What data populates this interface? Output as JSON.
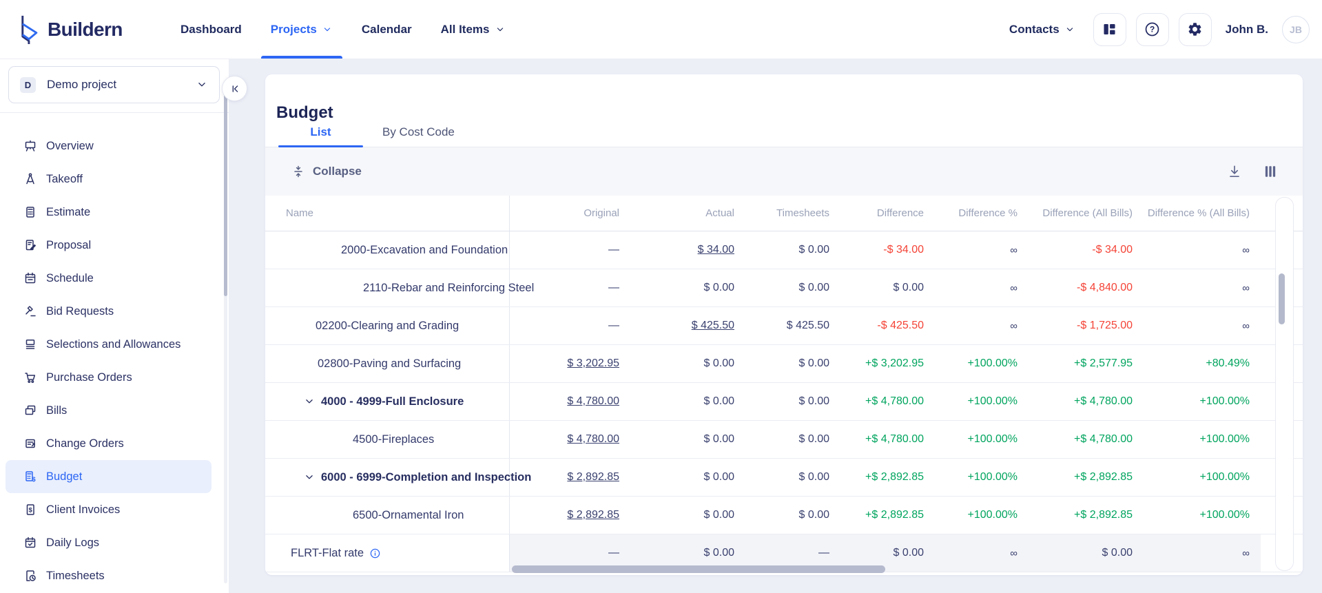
{
  "colors": {
    "accent": "#2d66f4",
    "navy": "#262e61",
    "red": "#f44336",
    "green": "#00a45e",
    "muted": "#9aa2b8",
    "bg": "#edeff7",
    "toolbar-bg": "#f6f7fa",
    "active-bg": "#e9effc",
    "scroll-thumb": "#b6bace"
  },
  "topbar": {
    "brand": "Buildern",
    "nav": [
      {
        "label": "Dashboard",
        "active": false,
        "chevron": false
      },
      {
        "label": "Projects",
        "active": true,
        "chevron": true
      },
      {
        "label": "Calendar",
        "active": false,
        "chevron": false
      },
      {
        "label": "All Items",
        "active": false,
        "chevron": true
      }
    ],
    "contacts_label": "Contacts",
    "user_name": "John B.",
    "avatar_initials": "JB"
  },
  "sidebar": {
    "project": {
      "badge": "D",
      "name": "Demo project"
    },
    "items": [
      {
        "label": "Overview",
        "icon": "easel"
      },
      {
        "label": "Takeoff",
        "icon": "compass"
      },
      {
        "label": "Estimate",
        "icon": "calculator"
      },
      {
        "label": "Proposal",
        "icon": "document-pen"
      },
      {
        "label": "Schedule",
        "icon": "calendar"
      },
      {
        "label": "Bid Requests",
        "icon": "gavel"
      },
      {
        "label": "Selections and Allowances",
        "icon": "layers"
      },
      {
        "label": "Purchase Orders",
        "icon": "cart"
      },
      {
        "label": "Bills",
        "icon": "bills"
      },
      {
        "label": "Change Orders",
        "icon": "doc-arrow"
      },
      {
        "label": "Budget",
        "icon": "budget",
        "active": true
      },
      {
        "label": "Client Invoices",
        "icon": "invoice"
      },
      {
        "label": "Daily Logs",
        "icon": "calendar-check"
      },
      {
        "label": "Timesheets",
        "icon": "doc-clock"
      }
    ]
  },
  "page": {
    "title": "Budget",
    "tabs": [
      {
        "label": "List",
        "active": true
      },
      {
        "label": "By Cost Code",
        "active": false
      }
    ],
    "toolbar": {
      "collapse_label": "Collapse"
    }
  },
  "table": {
    "columns": [
      "Name",
      "Original",
      "Actual",
      "Timesheets",
      "Difference",
      "Difference %",
      "Difference (All Bills)",
      "Difference % (All Bills)"
    ],
    "rows": [
      {
        "name": "2000-Excavation and Foundation",
        "indent": 80,
        "group": false,
        "info": false,
        "cells": [
          {
            "t": "—"
          },
          {
            "t": "$ 34.00",
            "link": true
          },
          {
            "t": "$ 0.00"
          },
          {
            "t": "-$ 34.00",
            "c": "red"
          },
          {
            "t": "∞"
          },
          {
            "t": "-$ 34.00",
            "c": "red"
          },
          {
            "t": "∞"
          }
        ]
      },
      {
        "name": "2110-Rebar and Reinforcing Steel",
        "indent": 112,
        "group": false,
        "info": false,
        "cells": [
          {
            "t": "—"
          },
          {
            "t": "$ 0.00"
          },
          {
            "t": "$ 0.00"
          },
          {
            "t": "$ 0.00"
          },
          {
            "t": "∞"
          },
          {
            "t": "-$ 4,840.00",
            "c": "red"
          },
          {
            "t": "∞"
          }
        ]
      },
      {
        "name": "02200-Clearing and Grading",
        "indent": 43,
        "group": false,
        "info": false,
        "cells": [
          {
            "t": "—"
          },
          {
            "t": "$ 425.50",
            "link": true
          },
          {
            "t": "$ 425.50"
          },
          {
            "t": "-$ 425.50",
            "c": "red"
          },
          {
            "t": "∞"
          },
          {
            "t": "-$ 1,725.00",
            "c": "red"
          },
          {
            "t": "∞"
          }
        ]
      },
      {
        "name": "02800-Paving and Surfacing",
        "indent": 46,
        "group": false,
        "info": false,
        "cells": [
          {
            "t": "$ 3,202.95",
            "link": true
          },
          {
            "t": "$ 0.00"
          },
          {
            "t": "$ 0.00"
          },
          {
            "t": "+$ 3,202.95",
            "c": "green"
          },
          {
            "t": "+100.00%",
            "c": "green"
          },
          {
            "t": "+$ 2,577.95",
            "c": "green"
          },
          {
            "t": "+80.49%",
            "c": "green"
          }
        ]
      },
      {
        "name": "4000 - 4999-Full Enclosure",
        "indent": 25,
        "group": true,
        "info": false,
        "cells": [
          {
            "t": "$ 4,780.00",
            "link": true
          },
          {
            "t": "$ 0.00"
          },
          {
            "t": "$ 0.00"
          },
          {
            "t": "+$ 4,780.00",
            "c": "green"
          },
          {
            "t": "+100.00%",
            "c": "green"
          },
          {
            "t": "+$ 4,780.00",
            "c": "green"
          },
          {
            "t": "+100.00%",
            "c": "green"
          }
        ]
      },
      {
        "name": "4500-Fireplaces",
        "indent": 97,
        "group": false,
        "info": false,
        "cells": [
          {
            "t": "$ 4,780.00",
            "link": true
          },
          {
            "t": "$ 0.00"
          },
          {
            "t": "$ 0.00"
          },
          {
            "t": "+$ 4,780.00",
            "c": "green"
          },
          {
            "t": "+100.00%",
            "c": "green"
          },
          {
            "t": "+$ 4,780.00",
            "c": "green"
          },
          {
            "t": "+100.00%",
            "c": "green"
          }
        ]
      },
      {
        "name": "6000 - 6999-Completion and Inspection",
        "indent": 25,
        "group": true,
        "info": false,
        "cells": [
          {
            "t": "$ 2,892.85",
            "link": true
          },
          {
            "t": "$ 0.00"
          },
          {
            "t": "$ 0.00"
          },
          {
            "t": "+$ 2,892.85",
            "c": "green"
          },
          {
            "t": "+100.00%",
            "c": "green"
          },
          {
            "t": "+$ 2,892.85",
            "c": "green"
          },
          {
            "t": "+100.00%",
            "c": "green"
          }
        ]
      },
      {
        "name": "6500-Ornamental Iron",
        "indent": 97,
        "group": false,
        "info": false,
        "cells": [
          {
            "t": "$ 2,892.85",
            "link": true
          },
          {
            "t": "$ 0.00"
          },
          {
            "t": "$ 0.00"
          },
          {
            "t": "+$ 2,892.85",
            "c": "green"
          },
          {
            "t": "+100.00%",
            "c": "green"
          },
          {
            "t": "+$ 2,892.85",
            "c": "green"
          },
          {
            "t": "+100.00%",
            "c": "green"
          }
        ]
      },
      {
        "name": "FLRT-Flat rate",
        "indent": 7,
        "group": false,
        "info": true,
        "cells": [
          {
            "t": "—"
          },
          {
            "t": "$ 0.00"
          },
          {
            "t": "—"
          },
          {
            "t": "$ 0.00"
          },
          {
            "t": "∞"
          },
          {
            "t": "$ 0.00"
          },
          {
            "t": "∞"
          }
        ]
      }
    ]
  }
}
